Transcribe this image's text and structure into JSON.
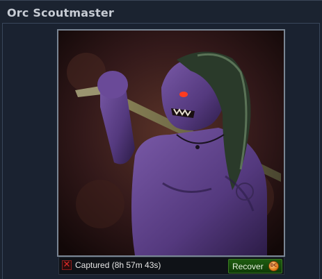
{
  "card": {
    "title": "Orc Scoutmaster"
  },
  "portrait": {
    "subject": "orc-with-sword-portrait"
  },
  "status": {
    "icon": "red-x-icon",
    "text": "Captured (8h 57m 43s)"
  },
  "recover_button": {
    "label": "Recover",
    "currency_icon": "dc-coin-icon",
    "currency_text": "DC"
  },
  "colors": {
    "background": "#1b2330",
    "title": "#c7ccd4",
    "button_green": "#1e5c10",
    "status_red": "#e02b2b",
    "coin_orange": "#e6831e"
  }
}
